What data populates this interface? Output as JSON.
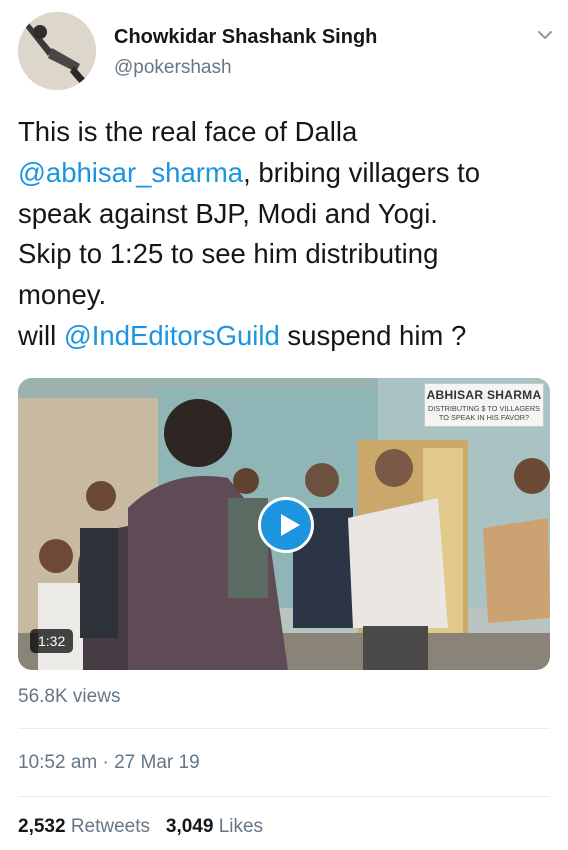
{
  "author": {
    "name": "Chowkidar Shashank Singh",
    "handle": "@pokershash"
  },
  "tweet": {
    "lines": [
      [
        {
          "text": "This is the real face of Dalla",
          "mention": false
        }
      ],
      [
        {
          "text": "@abhisar_sharma",
          "mention": true
        },
        {
          "text": ", bribing villagers to",
          "mention": false
        }
      ],
      [
        {
          "text": "speak against BJP, Modi and Yogi.",
          "mention": false
        }
      ],
      [
        {
          "text": "Skip to 1:25 to see him distributing",
          "mention": false
        }
      ],
      [
        {
          "text": "money.",
          "mention": false
        }
      ],
      [
        {
          "text": "will ",
          "mention": false
        },
        {
          "text": "@IndEditorsGuild",
          "mention": true
        },
        {
          "text": " suspend him ?",
          "mention": false
        }
      ]
    ]
  },
  "media": {
    "watermark_title": "ABHISAR SHARMA",
    "watermark_subtitle": "DISTRIBUTING $ TO VILLAGERS TO SPEAK IN HIS FAVOR?",
    "duration": "1:32"
  },
  "meta": {
    "views": "56.8K views",
    "timestamp": "10:52 am · 27 Mar 19",
    "retweets_count": "2,532",
    "retweets_label": "Retweets",
    "likes_count": "3,049",
    "likes_label": "Likes"
  },
  "colors": {
    "link": "#1b95e0",
    "secondary_text": "#657786",
    "primary_text": "#14171a",
    "play_button": "#1b95e0"
  },
  "icons": {
    "menu": "chevron-down-icon",
    "play": "play-icon"
  }
}
